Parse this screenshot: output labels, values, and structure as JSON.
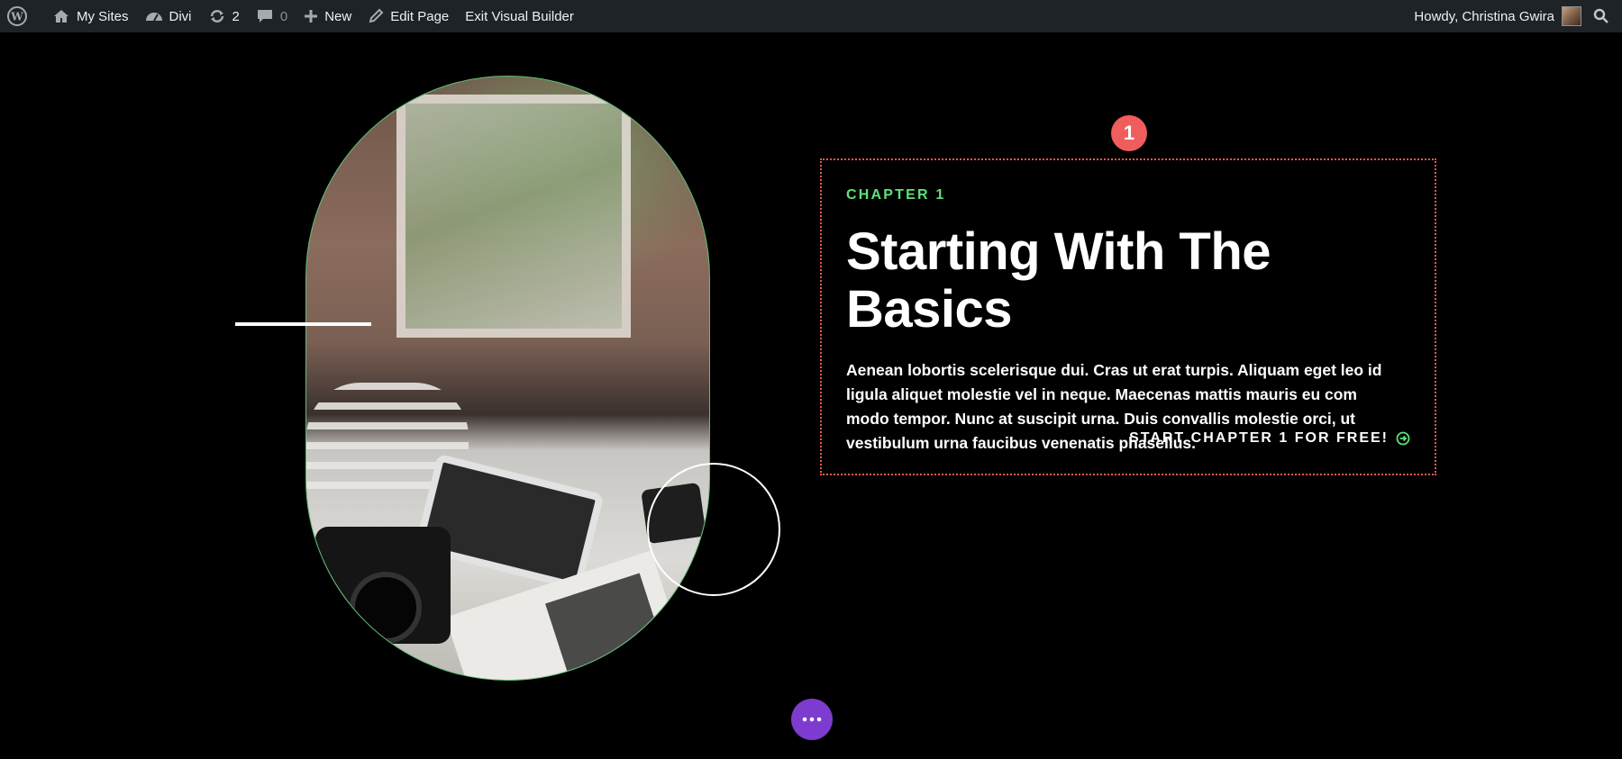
{
  "admin_bar": {
    "items": [
      {
        "label": "My Sites",
        "icon": "home-icon"
      },
      {
        "label": "Divi",
        "icon": "dashboard-icon"
      },
      {
        "label": "2",
        "icon": "updates-icon"
      },
      {
        "label": "0",
        "icon": "comment-icon"
      },
      {
        "label": "New",
        "icon": "plus-icon"
      },
      {
        "label": "Edit Page",
        "icon": "pencil-icon"
      },
      {
        "label": "Exit Visual Builder"
      }
    ],
    "greeting": "Howdy, Christina Gwira"
  },
  "section": {
    "badge": "1",
    "chapter_label": "CHAPTER 1",
    "heading": "Starting With The Basics",
    "body": "Aenean lobortis scelerisque dui. Cras ut erat turpis. Aliquam eget leo id ligula aliquet molestie vel in neque. Maecenas mattis mauris eu com modo tempor. Nunc at suscipit urna. Duis convallis molestie orci, ut vestibulum urna faucibus venenatis phasellus.",
    "cta_label": "START CHAPTER 1 FOR FREE!"
  },
  "colors": {
    "accent_green": "#5ee27a",
    "badge_red": "#ef5d5d",
    "builder_purple": "#7e3bd0",
    "adminbar_bg": "#1d2327"
  }
}
